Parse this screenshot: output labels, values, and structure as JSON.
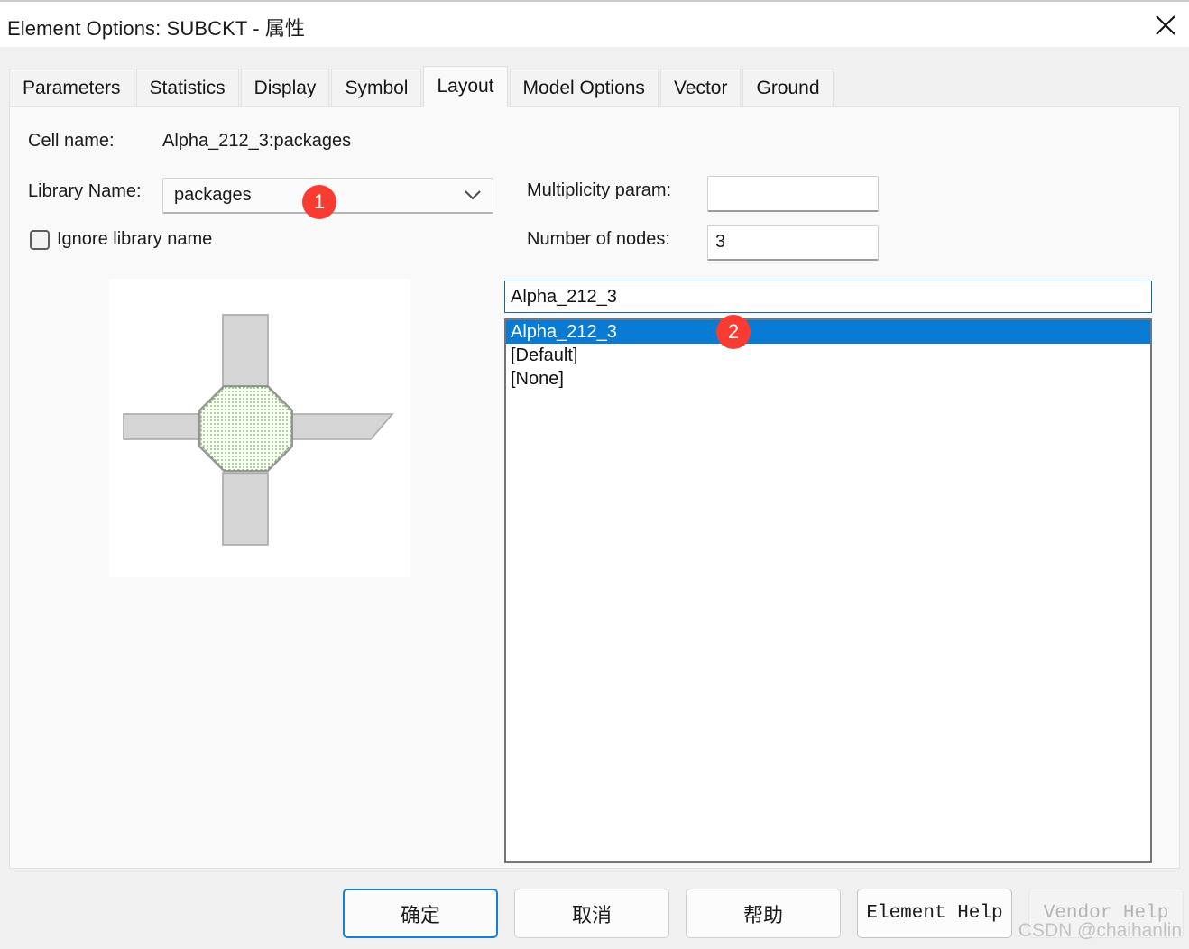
{
  "window": {
    "title": "Element Options: SUBCKT -  属性",
    "close_icon": "close-icon"
  },
  "tabs": [
    {
      "label": "Parameters",
      "active": false
    },
    {
      "label": "Statistics",
      "active": false
    },
    {
      "label": "Display",
      "active": false
    },
    {
      "label": "Symbol",
      "active": false
    },
    {
      "label": "Layout",
      "active": true
    },
    {
      "label": "Model Options",
      "active": false
    },
    {
      "label": "Vector",
      "active": false
    },
    {
      "label": "Ground",
      "active": false
    }
  ],
  "form": {
    "cell_name_label": "Cell name:",
    "cell_name_value": "Alpha_212_3:packages",
    "library_name_label": "Library Name:",
    "library_name_value": "packages",
    "library_name_options": [
      "packages"
    ],
    "ignore_library_label": "Ignore library name",
    "ignore_library_checked": false,
    "multiplicity_label": "Multiplicity param:",
    "multiplicity_value": "",
    "multiplicity_placeholder": "",
    "nodes_label": "Number of nodes:",
    "nodes_value": "3"
  },
  "name_field": {
    "value": "Alpha_212_3",
    "placeholder": ""
  },
  "list": {
    "items": [
      {
        "label": "Alpha_212_3",
        "selected": true
      },
      {
        "label": "[Default]",
        "selected": false
      },
      {
        "label": "[None]",
        "selected": false
      }
    ]
  },
  "preview": {
    "name": "layout-preview",
    "shape_fill": "#d5d5d5",
    "shape_stroke": "#a8a8a8",
    "octagon_fill": "#e6f7e0",
    "octagon_dot": "#8cd66a"
  },
  "badges": [
    {
      "label": "1",
      "color": "#fa3b32"
    },
    {
      "label": "2",
      "color": "#fa3b32"
    }
  ],
  "buttons": {
    "ok": "确定",
    "cancel": "取消",
    "help": "帮助",
    "element_help": "Element Help",
    "vendor_help": "Vendor Help"
  },
  "watermark": "CSDN @chaihanlin",
  "colors": {
    "selection_blue": "#0a7bd4",
    "badge_red": "#fa3b32",
    "dialog_bg": "#f0f0f0",
    "panel_bg": "#f9f9f9",
    "focus_border": "#1a7ed6"
  }
}
